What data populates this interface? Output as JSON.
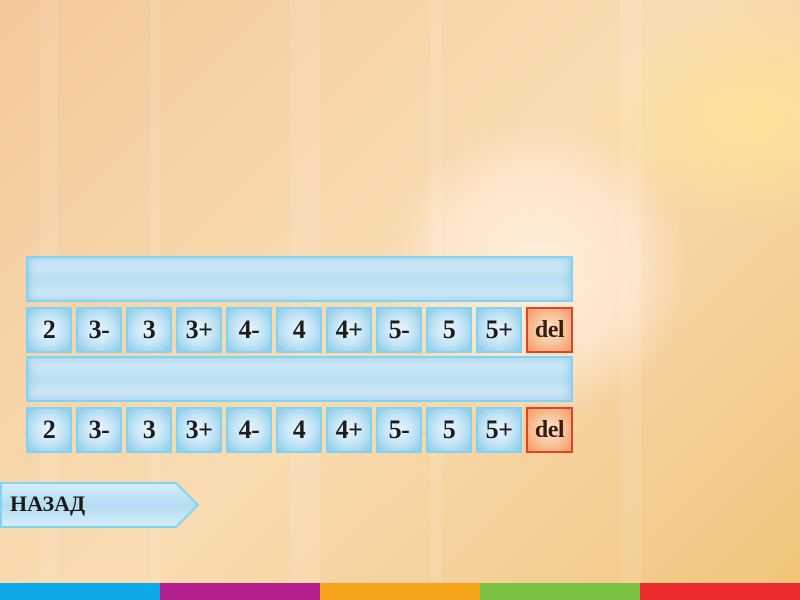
{
  "row1": {
    "keys": [
      "2",
      "3-",
      "3",
      "3+",
      "4-",
      "4",
      "4+",
      "5-",
      "5",
      "5+"
    ],
    "delete_label": "del"
  },
  "row2": {
    "keys": [
      "2",
      "3-",
      "3",
      "3+",
      "4-",
      "4",
      "4+",
      "5-",
      "5",
      "5+"
    ],
    "delete_label": "del"
  },
  "back_button": {
    "label": "НАЗАД"
  },
  "colors": {
    "key_border": "#7fd3f3",
    "delete_border": "#e0432a",
    "stripes": [
      "#0da9e8",
      "#b4208e",
      "#f6a41a",
      "#7bc144",
      "#ea2a2b"
    ]
  }
}
